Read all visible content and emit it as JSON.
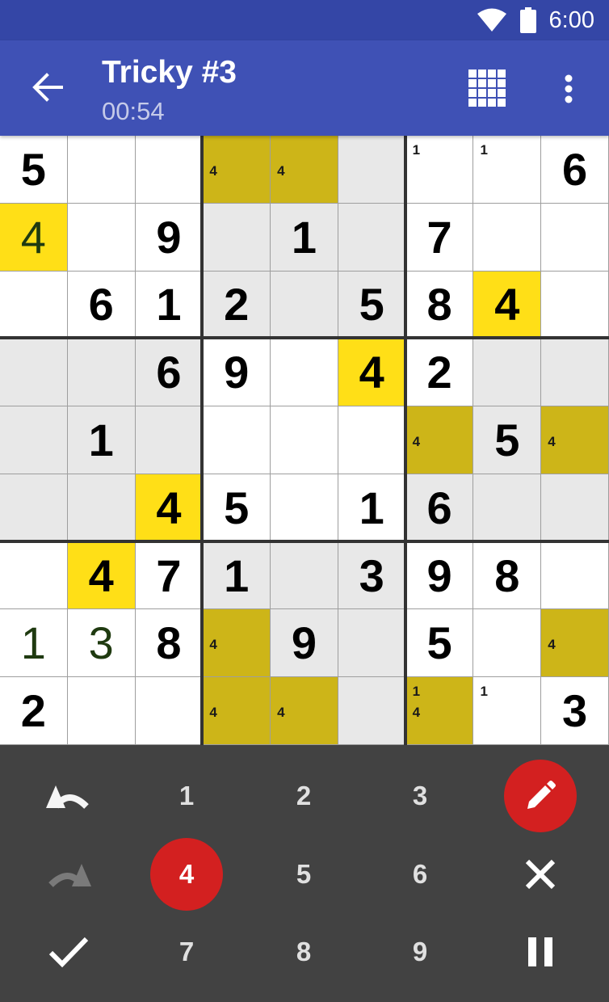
{
  "status_bar": {
    "time": "6:00"
  },
  "header": {
    "title": "Tricky #3",
    "timer": "00:54"
  },
  "colors": {
    "status_bar": "#3446a6",
    "app_bar": "#3f51b5",
    "selected_cell": "#ffdf17",
    "candidate_highlight": "#cdb518",
    "related_cell": "#e8e8e8",
    "keypad": "#424242",
    "accent_red": "#d32020"
  },
  "board": {
    "rows": [
      [
        {
          "v": "5"
        },
        {},
        {},
        {
          "n": [
            "4"
          ]
        },
        {
          "n": [
            "4"
          ]
        },
        {},
        {
          "n": [
            "1"
          ]
        },
        {
          "n": [
            "1"
          ]
        },
        {
          "v": "6"
        }
      ],
      [
        {
          "u": "4"
        },
        {},
        {
          "v": "9"
        },
        {},
        {
          "v": "1"
        },
        {},
        {
          "v": "7"
        },
        {},
        {}
      ],
      [
        {},
        {
          "v": "6"
        },
        {
          "v": "1"
        },
        {
          "v": "2"
        },
        {},
        {
          "v": "5"
        },
        {
          "v": "8"
        },
        {
          "v": "4"
        },
        {}
      ],
      [
        {},
        {},
        {
          "v": "6"
        },
        {
          "v": "9"
        },
        {},
        {
          "v": "4"
        },
        {
          "v": "2"
        },
        {},
        {}
      ],
      [
        {},
        {
          "v": "1"
        },
        {},
        {},
        {},
        {},
        {
          "n": [
            "4"
          ]
        },
        {
          "v": "5"
        },
        {
          "n": [
            "4"
          ]
        }
      ],
      [
        {},
        {},
        {
          "v": "4"
        },
        {
          "v": "5"
        },
        {},
        {
          "v": "1"
        },
        {
          "v": "6"
        },
        {},
        {}
      ],
      [
        {},
        {
          "v": "4"
        },
        {
          "v": "7"
        },
        {
          "v": "1"
        },
        {},
        {
          "v": "3"
        },
        {
          "v": "9"
        },
        {
          "v": "8"
        },
        {}
      ],
      [
        {
          "u": "1"
        },
        {
          "u": "3"
        },
        {
          "v": "8"
        },
        {
          "n": [
            "4"
          ]
        },
        {
          "v": "9"
        },
        {},
        {
          "v": "5"
        },
        {},
        {
          "n": [
            "4"
          ]
        }
      ],
      [
        {
          "v": "2"
        },
        {},
        {},
        {
          "n": [
            "4"
          ]
        },
        {
          "n": [
            "4"
          ]
        },
        {},
        {
          "n": [
            "1",
            "4"
          ]
        },
        {
          "n": [
            "1"
          ]
        },
        {
          "v": "3"
        }
      ]
    ],
    "bg": [
      "WWWHHGWWW",
      "YWWGGGWWW",
      "WWWGGGWYW",
      "GGGWWYWGG",
      "GGGWWWHGH",
      "GGYWWWGGG",
      "WYWGGGWWW",
      "WWWHGGWWH",
      "WWWHHGHWW"
    ]
  },
  "keypad": {
    "numbers": [
      "1",
      "2",
      "3",
      "4",
      "5",
      "6",
      "7",
      "8",
      "9"
    ],
    "selected_number": "4",
    "icons": [
      "undo-icon",
      "redo-icon",
      "check-icon",
      "pencil-icon",
      "clear-icon",
      "pause-icon"
    ],
    "pencil_mode": true
  }
}
